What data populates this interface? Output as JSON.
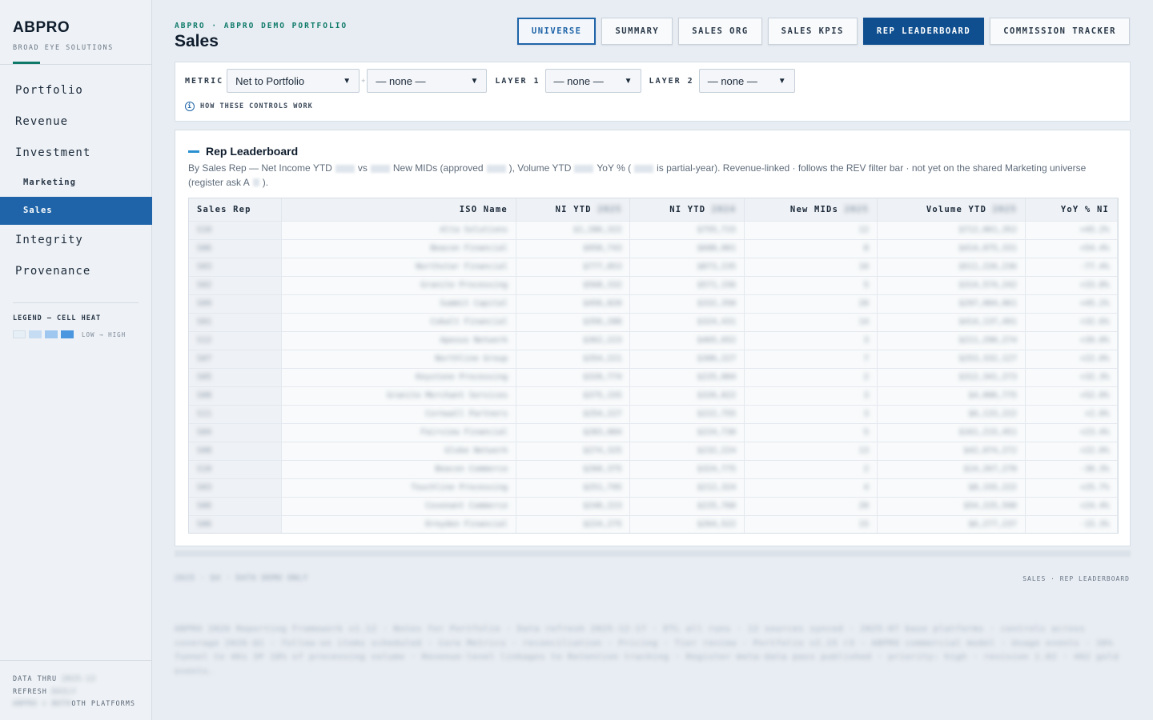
{
  "brand": {
    "name": "ABPRO",
    "sub": "BROAD EYE SOLUTIONS"
  },
  "nav": {
    "portfolio": "Portfolio",
    "revenue": "Revenue",
    "investment": "Investment",
    "marketing": "Marketing",
    "sales": "Sales",
    "integrity": "Integrity",
    "provenance": "Provenance"
  },
  "legend": {
    "title": "LEGEND — CELL HEAT",
    "range": "LOW → HIGH",
    "colors": [
      "#e6eef6",
      "#c5dcf2",
      "#9ec6ee",
      "#4a97e0"
    ]
  },
  "sidebar_footer": {
    "data_thru_label": "DATA THRU",
    "data_thru_value": "2025-12",
    "refresh_label": "REFRESH",
    "refresh_value": "DAILY",
    "platforms_prefix": "ABPRO + BOTH",
    "platforms_label": "OTH PLATFORMS"
  },
  "header": {
    "breadcrumb": "ABPRO · ABPRO DEMO PORTFOLIO",
    "title": "Sales"
  },
  "tabs": {
    "universe": "UNIVERSE",
    "summary": "SUMMARY",
    "sales_org": "SALES ORG",
    "sales_kpis": "SALES KPIS",
    "rep_leaderboard": "REP LEADERBOARD",
    "commission_tracker": "COMMISSION TRACKER"
  },
  "controls": {
    "metric_label": "METRIC",
    "metric_value": "Net to Portfolio",
    "extra_value": "— none —",
    "layer1_label": "LAYER 1",
    "layer1_value": "— none —",
    "layer2_label": "LAYER 2",
    "layer2_value": "— none —",
    "help": "HOW THESE CONTROLS WORK"
  },
  "leaderboard": {
    "title": "Rep Leaderboard",
    "desc_a": "By Sales Rep — Net Income YTD",
    "desc_b": "vs",
    "desc_c": "New MIDs (approved",
    "desc_d": "), Volume YTD",
    "desc_e": "YoY % (",
    "desc_f": "is partial-year). Revenue-linked · follows the REV filter bar · not yet on the shared Marketing universe (register ask A",
    "desc_g": ").",
    "columns": {
      "rep": "Sales Rep",
      "iso": "ISO Name",
      "ni1": "NI YTD",
      "ni1_year": "2025",
      "ni2": "NI YTD",
      "ni2_year": "2024",
      "mids": "New MIDs",
      "mids_year": "2025",
      "vol": "Volume YTD",
      "vol_year": "2025",
      "yoy": "YoY % NI"
    },
    "rows": [
      {
        "rep": "S10",
        "iso": "Alta Solutions",
        "ni1": "$1,286,322",
        "ni2": "$755,715",
        "mids": "12",
        "vol": "$712,061,352",
        "yoy": "+45.2%"
      },
      {
        "rep": "S06",
        "iso": "Beacon Financial",
        "ni1": "$958,743",
        "ni2": "$688,001",
        "mids": "8",
        "vol": "$414,075,331",
        "yoy": "+54.4%"
      },
      {
        "rep": "S03",
        "iso": "Northstar Financial",
        "ni1": "$777,853",
        "ni2": "$873,235",
        "mids": "10",
        "vol": "$511,226,236",
        "yoy": "-77.4%"
      },
      {
        "rep": "S02",
        "iso": "Granite Processing",
        "ni1": "$568,332",
        "ni2": "$571,156",
        "mids": "5",
        "vol": "$314,574,242",
        "yoy": "+33.8%"
      },
      {
        "rep": "S09",
        "iso": "Summit Capital",
        "ni1": "$456,820",
        "ni2": "$332,350",
        "mids": "20",
        "vol": "$297,004,061",
        "yoy": "+45.2%"
      },
      {
        "rep": "S01",
        "iso": "Cobalt Financial",
        "ni1": "$356,288",
        "ni2": "$324,431",
        "mids": "14",
        "vol": "$414,137,491",
        "yoy": "+32.6%"
      },
      {
        "rep": "S12",
        "iso": "Apexus Network",
        "ni1": "$362,223",
        "ni2": "$465,652",
        "mids": "3",
        "vol": "$211,290,274",
        "yoy": "+39.0%"
      },
      {
        "rep": "S07",
        "iso": "Northline Group",
        "ni1": "$354,221",
        "ni2": "$306,227",
        "mids": "7",
        "vol": "$253,332,127",
        "yoy": "+22.0%"
      },
      {
        "rep": "S05",
        "iso": "Keystone Processing",
        "ni1": "$320,774",
        "ni2": "$225,004",
        "mids": "2",
        "vol": "$312,341,273",
        "yoy": "+32.3%"
      },
      {
        "rep": "S08",
        "iso": "Granite Merchant Services",
        "ni1": "$375,155",
        "ni2": "$326,822",
        "mids": "3",
        "vol": "$4,006,775",
        "yoy": "+52.0%"
      },
      {
        "rep": "S11",
        "iso": "Cornwall Partners",
        "ni1": "$254,227",
        "ni2": "$222,755",
        "mids": "3",
        "vol": "$6,133,222",
        "yoy": "+2.0%"
      },
      {
        "rep": "S04",
        "iso": "Fairview Financial",
        "ni1": "$283,004",
        "ni2": "$224,730",
        "mids": "5",
        "vol": "$161,215,451",
        "yoy": "+23.4%"
      },
      {
        "rep": "S08",
        "iso": "Globe Network",
        "ni1": "$274,325",
        "ni2": "$232,224",
        "mids": "13",
        "vol": "$42,074,272",
        "yoy": "+22.0%"
      },
      {
        "rep": "S10",
        "iso": "Beacon Commerce",
        "ni1": "$260,375",
        "ni2": "$324,775",
        "mids": "2",
        "vol": "$14,267,270",
        "yoy": "-30.3%"
      },
      {
        "rep": "S03",
        "iso": "Touchline Processing",
        "ni1": "$251,795",
        "ni2": "$212,324",
        "mids": "4",
        "vol": "$8,155,222",
        "yoy": "+25.7%"
      },
      {
        "rep": "S06",
        "iso": "Covenant Commerce",
        "ni1": "$240,223",
        "ni2": "$225,760",
        "mids": "20",
        "vol": "$54,225,590",
        "yoy": "+24.4%"
      },
      {
        "rep": "S06",
        "iso": "Dreyden Financial",
        "ni1": "$224,275",
        "ni2": "$264,522",
        "mids": "15",
        "vol": "$6,277,237",
        "yoy": "-15.3%"
      }
    ]
  },
  "footer": {
    "left": "2025 · Q4 · DATA DEMO ONLY",
    "right": "SALES · REP LEADERBOARD",
    "para": "ABPRO 2026 Reporting Framework v1.12 · Notes for Portfolio · Data refresh 2025-12-17 · ETL all runs · 12 sources synced · 2025-07 base platforms · controls across coverage 2026-Q1 · follow-on items scheduled · Core Metrics · reconciliation · Pricing · Tier review · Portfolio v2.15 r3 · ABPRO commercial model · Usage events · 30% funnel to 4Ks 3P 18% of processing volume · Revenue-level linkages to Retention tracking · Register meta-data pass published · priority: high · revision 1.02 · 402 gold events."
  }
}
